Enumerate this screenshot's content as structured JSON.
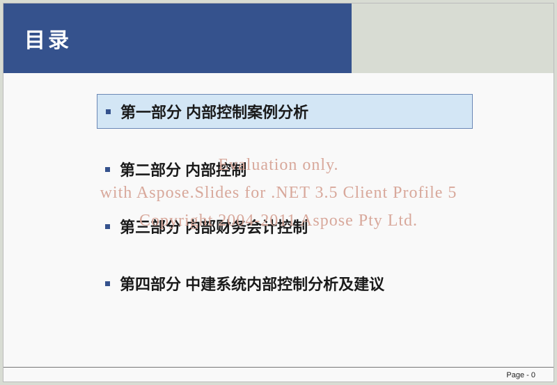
{
  "title": "目录",
  "toc": [
    {
      "label": "第一部分  内部控制案例分析",
      "highlight": true
    },
    {
      "label": "第二部分  内部控制",
      "highlight": false
    },
    {
      "label": "第三部分  内部财务会计控制",
      "highlight": false
    },
    {
      "label": "第四部分  中建系统内部控制分析及建议",
      "highlight": false
    }
  ],
  "watermark": {
    "line1": "Evaluation only.",
    "line2": "with Aspose.Slides for .NET 3.5 Client Profile 5",
    "line3": "Copyright 2004-2011 Aspose Pty Ltd."
  },
  "page_label": "Page  -  0"
}
